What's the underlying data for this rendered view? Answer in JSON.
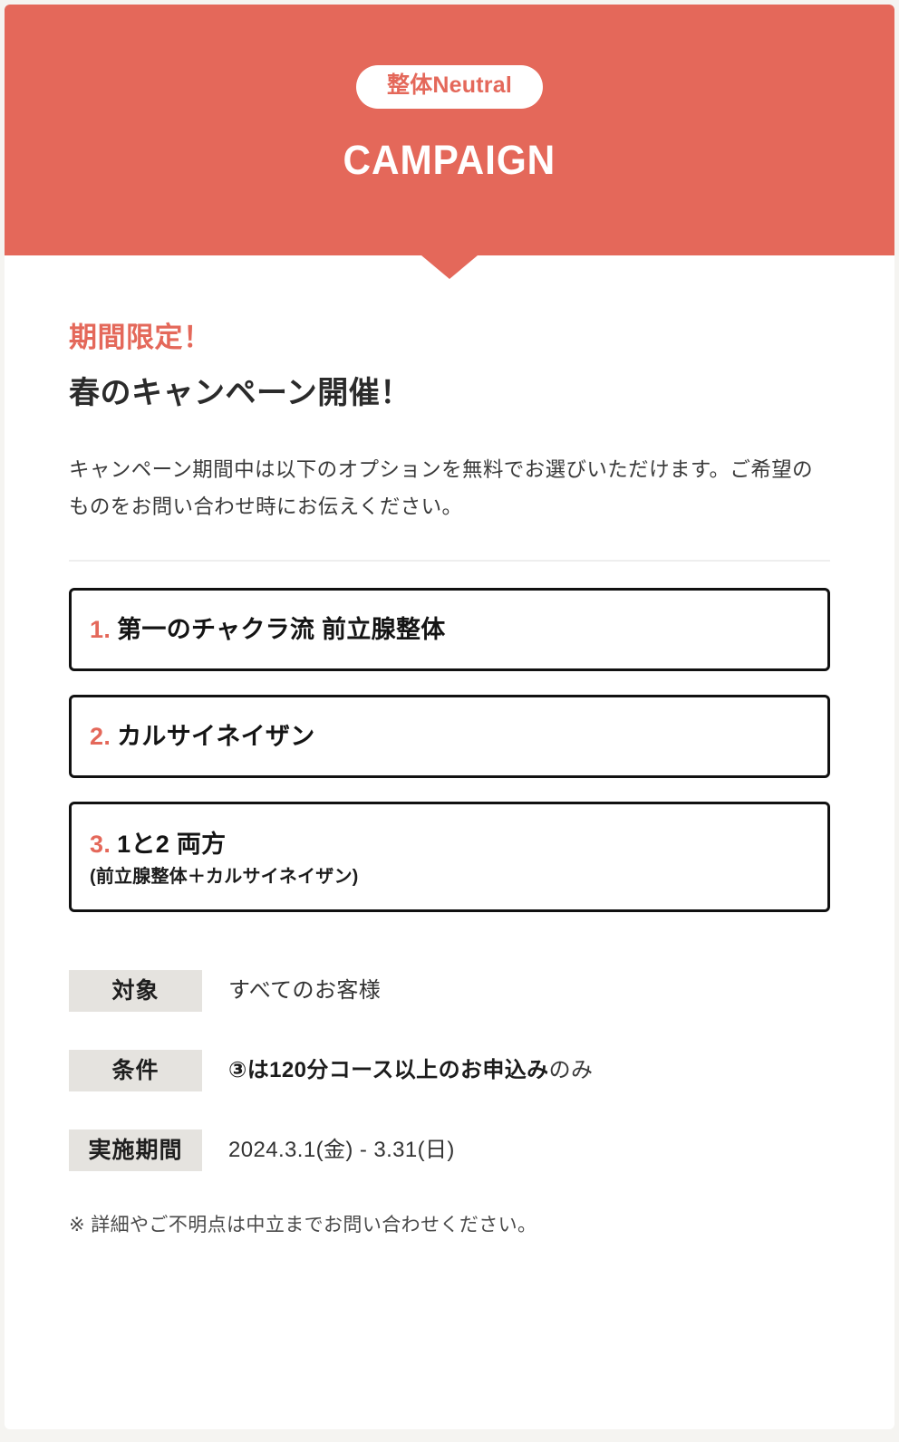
{
  "page": {
    "background_color": "#f5f4f1",
    "card_background": "#ffffff",
    "accent_color": "#e4685a",
    "label_chip_color": "#e5e3df"
  },
  "header": {
    "brand_badge": "整体Neutral",
    "title": "CAMPAIGN"
  },
  "intro": {
    "eyebrow": "期間限定！",
    "headline": "春のキャンペーン開催！",
    "lead": "キャンペーン期間中は以下のオプションを無料でお選びいただけます。ご希望のものをお問い合わせ時にお伝えください。"
  },
  "options": [
    {
      "number": "1.",
      "title": "第一のチャクラ流 前立腺整体",
      "sub": ""
    },
    {
      "number": "2.",
      "title": "カルサイネイザン",
      "sub": ""
    },
    {
      "number": "3.",
      "title": "1と2 両方",
      "sub": "(前立腺整体＋カルサイネイザン)"
    }
  ],
  "details": [
    {
      "label": "対象",
      "value": "すべてのお客様",
      "value_tail": ""
    },
    {
      "label": "条件",
      "value": "③は120分コース以上のお申込み",
      "value_tail": "のみ"
    },
    {
      "label": "実施期間",
      "value": "2024.3.1(金) - 3.31(日)",
      "value_tail": ""
    }
  ],
  "footnote": "※ 詳細やご不明点は中立までお問い合わせください。"
}
